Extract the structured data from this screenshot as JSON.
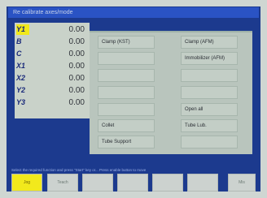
{
  "window": {
    "title": "Re calibrate axes/mode"
  },
  "axes": [
    {
      "name": "Y1",
      "value": "0.00",
      "highlight": true
    },
    {
      "name": "B",
      "value": "0.00",
      "highlight": false
    },
    {
      "name": "C",
      "value": "0.00",
      "highlight": false
    },
    {
      "name": "X1",
      "value": "0.00",
      "highlight": false
    },
    {
      "name": "X2",
      "value": "0.00",
      "highlight": false
    },
    {
      "name": "Y2",
      "value": "0.00",
      "highlight": false
    },
    {
      "name": "Y3",
      "value": "0.00",
      "highlight": false
    }
  ],
  "functions": {
    "left": [
      "Clamp (KST)",
      "",
      "",
      "",
      "",
      "Collet",
      "Tube Support"
    ],
    "right": [
      "Clamp (AFM)",
      "Immobilizer (AFM)",
      "",
      "",
      "Open all",
      "Tube Lub.",
      ""
    ]
  },
  "status_text": "Select the required function and press \"Start\" key or... Press enable button to move",
  "softkeys": [
    {
      "label": "Jog",
      "active": true
    },
    {
      "label": "Teach",
      "active": false
    },
    {
      "label": "",
      "active": false
    },
    {
      "label": "",
      "active": false
    },
    {
      "label": "",
      "active": false
    },
    {
      "label": "",
      "active": false
    },
    {
      "label": "Mis",
      "active": false
    }
  ],
  "colors": {
    "frame": "#1c3a8e",
    "titlebar": "#2a53c4",
    "highlight": "#f2e91c",
    "panel": "#c9d2c9"
  }
}
